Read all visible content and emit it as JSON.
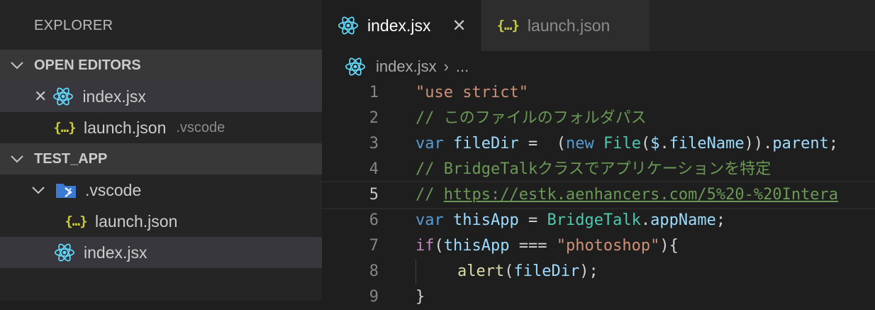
{
  "explorer": {
    "title": "EXPLORER",
    "open_editors": {
      "header": "OPEN EDITORS",
      "items": [
        {
          "label": "index.jsx",
          "icon": "react-icon"
        },
        {
          "label": "launch.json",
          "description": ".vscode",
          "icon": "json-icon"
        }
      ]
    },
    "project": {
      "header": "TEST_APP",
      "items": [
        {
          "label": ".vscode",
          "icon": "vscode-folder-icon"
        },
        {
          "label": "launch.json",
          "icon": "json-icon"
        },
        {
          "label": "index.jsx",
          "icon": "react-icon"
        }
      ]
    }
  },
  "tabs": [
    {
      "label": "index.jsx",
      "active": true,
      "icon": "react-icon"
    },
    {
      "label": "launch.json",
      "active": false,
      "icon": "json-icon"
    }
  ],
  "icons": {
    "json": "{…}",
    "close": "✕"
  },
  "breadcrumb": {
    "file": "index.jsx",
    "separator": "›",
    "more": "..."
  },
  "code": {
    "line_numbers": [
      "1",
      "2",
      "3",
      "4",
      "5",
      "6",
      "7",
      "8",
      "9"
    ],
    "l1_str": "\"use strict\"",
    "l2_comment": "// このファイルのフォルダパス",
    "l3_var": "var",
    "l3_name": "fileDir",
    "l3_eq": " =  (",
    "l3_new": "new",
    "l3_file": "File",
    "l3_paren": "(",
    "l3_dollar": "$",
    "l3_dot": ".",
    "l3_filename": "fileName",
    "l3_close": ")).",
    "l3_parent": "parent",
    "l3_semi": ";",
    "l4_comment": "// BridgeTalkクラスでアプリケーションを特定",
    "l5_prefix": "// ",
    "l5_link": "https://estk.aenhancers.com/5%20-%20Intera",
    "l6_var": "var",
    "l6_name": "thisApp",
    "l6_eq": " = ",
    "l6_cls": "BridgeTalk",
    "l6_dot": ".",
    "l6_prop": "appName",
    "l6_semi": ";",
    "l7_if": "if",
    "l7_open": "(",
    "l7_name": "thisApp",
    "l7_op": " === ",
    "l7_str": "\"photoshop\"",
    "l7_close": "){",
    "l8_fn": "alert",
    "l8_open": "(",
    "l8_arg": "fileDir",
    "l8_close": ");",
    "l9_brace": "}"
  },
  "colors": {
    "react": "#61dafb",
    "json": "#cbcb41",
    "folder": "#3b79d3",
    "editor_bg": "#1e1e1e",
    "sidebar_bg": "#252526"
  }
}
